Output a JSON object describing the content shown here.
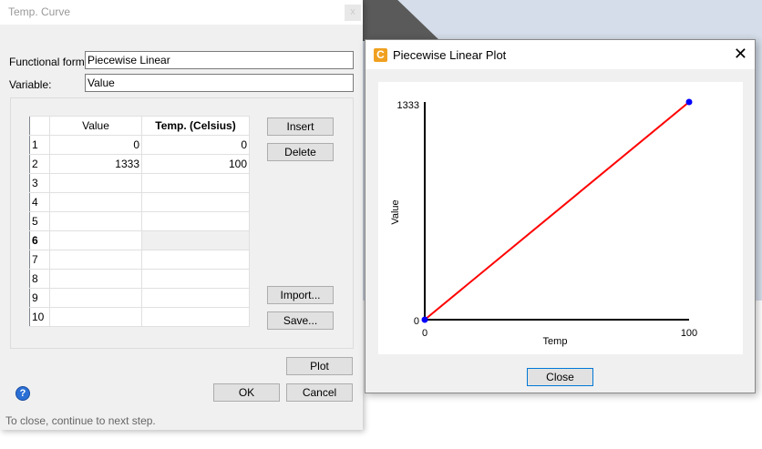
{
  "main_dialog": {
    "title": "Temp. Curve",
    "close_label": "x",
    "functional_form_label": "Functional form:",
    "functional_form_value": "Piecewise Linear",
    "variable_label": "Variable:",
    "variable_value": "Value",
    "table": {
      "headers": [
        "Value",
        "Temp. (Celsius)"
      ],
      "rows": [
        {
          "n": "1",
          "value": "0",
          "temp": "0"
        },
        {
          "n": "2",
          "value": "1333",
          "temp": "100"
        },
        {
          "n": "3",
          "value": "",
          "temp": ""
        },
        {
          "n": "4",
          "value": "",
          "temp": ""
        },
        {
          "n": "5",
          "value": "",
          "temp": ""
        },
        {
          "n": "6",
          "value": "",
          "temp": ""
        },
        {
          "n": "7",
          "value": "",
          "temp": ""
        },
        {
          "n": "8",
          "value": "",
          "temp": ""
        },
        {
          "n": "9",
          "value": "",
          "temp": ""
        },
        {
          "n": "10",
          "value": "",
          "temp": ""
        }
      ]
    },
    "buttons": {
      "insert": "Insert",
      "delete": "Delete",
      "import": "Import...",
      "save": "Save...",
      "plot": "Plot",
      "ok": "OK",
      "cancel": "Cancel"
    },
    "help_icon": "?",
    "status": "To close, continue to next step."
  },
  "plot_dialog": {
    "title": "Piecewise Linear Plot",
    "app_icon_letter": "C",
    "close_x": "✕",
    "close_button": "Close"
  },
  "chart_data": {
    "type": "line",
    "xlabel": "Temp",
    "ylabel": "Value",
    "x": [
      0,
      100
    ],
    "y": [
      0,
      1333
    ],
    "xlim": [
      0,
      100
    ],
    "ylim": [
      0,
      1333
    ],
    "x_ticks": [
      "0",
      "100"
    ],
    "y_ticks": [
      "0",
      "1333"
    ],
    "line_color": "#ff0000",
    "marker_color": "#0000ff"
  }
}
